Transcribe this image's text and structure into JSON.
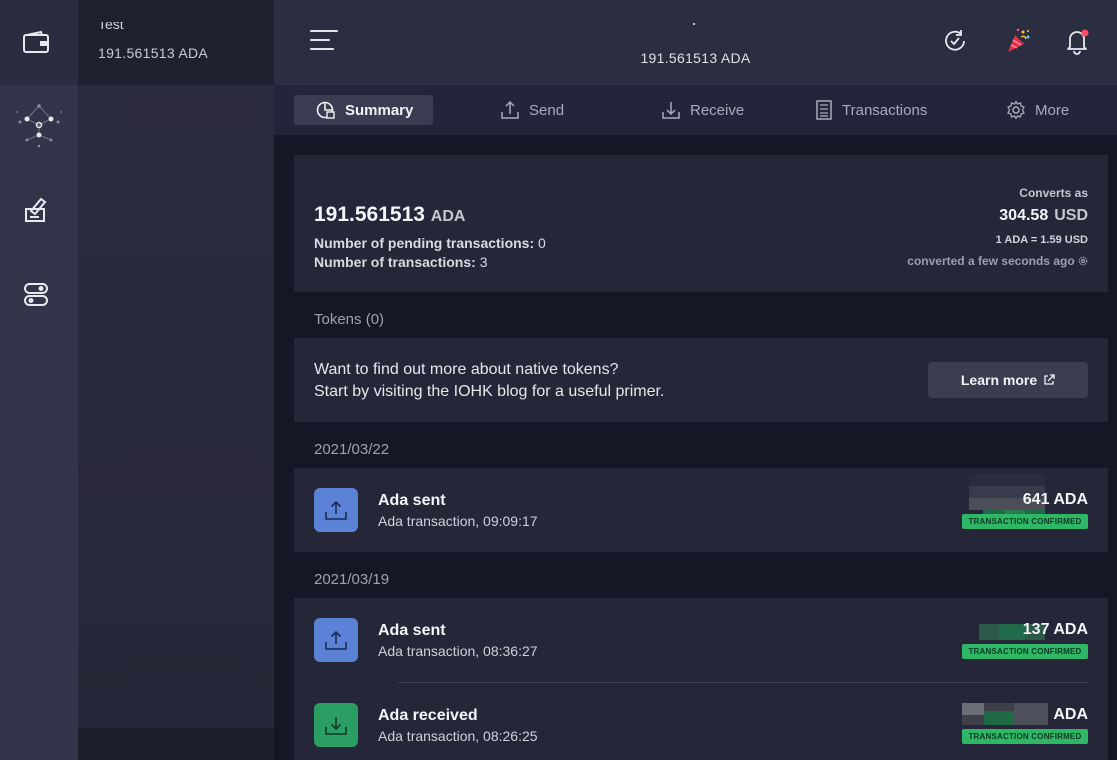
{
  "wallet": {
    "name": "Test",
    "balance": "191.561513 ADA"
  },
  "topbar": {
    "title": "191.561513 ADA"
  },
  "tabs": [
    {
      "label": "Summary",
      "icon": "summary-icon",
      "active": true
    },
    {
      "label": "Send",
      "icon": "send-icon",
      "active": false
    },
    {
      "label": "Receive",
      "icon": "receive-icon",
      "active": false
    },
    {
      "label": "Transactions",
      "icon": "transactions-icon",
      "active": false
    },
    {
      "label": "More",
      "icon": "gear-icon",
      "active": false
    }
  ],
  "summary": {
    "amount": "191.561513",
    "unit": "ADA",
    "pending_label": "Number of pending transactions:",
    "pending_value": "0",
    "count_label": "Number of transactions:",
    "count_value": "3",
    "converts_label": "Converts as",
    "usd_value": "304.58",
    "usd_unit": "USD",
    "rate": "1 ADA = 1.59 USD",
    "converted_time": "converted a few seconds ago"
  },
  "tokens": {
    "label": "Tokens (0)",
    "line1": "Want to find out more about native tokens?",
    "line2": "Start by visiting the IOHK blog for a useful primer.",
    "button": "Learn more"
  },
  "groups": [
    {
      "date": "2021/03/22",
      "transactions": [
        {
          "title": "Ada sent",
          "subtitle": "Ada transaction, 09:09:17",
          "amount": "641 ADA",
          "status": "TRANSACTION CONFIRMED",
          "type": "sent"
        }
      ]
    },
    {
      "date": "2021/03/19",
      "transactions": [
        {
          "title": "Ada sent",
          "subtitle": "Ada transaction, 08:36:27",
          "amount": "137 ADA",
          "status": "TRANSACTION CONFIRMED",
          "type": "sent"
        },
        {
          "title": "Ada received",
          "subtitle": "Ada transaction, 08:26:25",
          "amount": "ADA",
          "status": "TRANSACTION CONFIRMED",
          "type": "received"
        }
      ]
    }
  ],
  "colors": {
    "sent": "#5b82d6",
    "received": "#2b9e64",
    "confirmed": "#2eb766",
    "notification": "#ff4d5e"
  }
}
